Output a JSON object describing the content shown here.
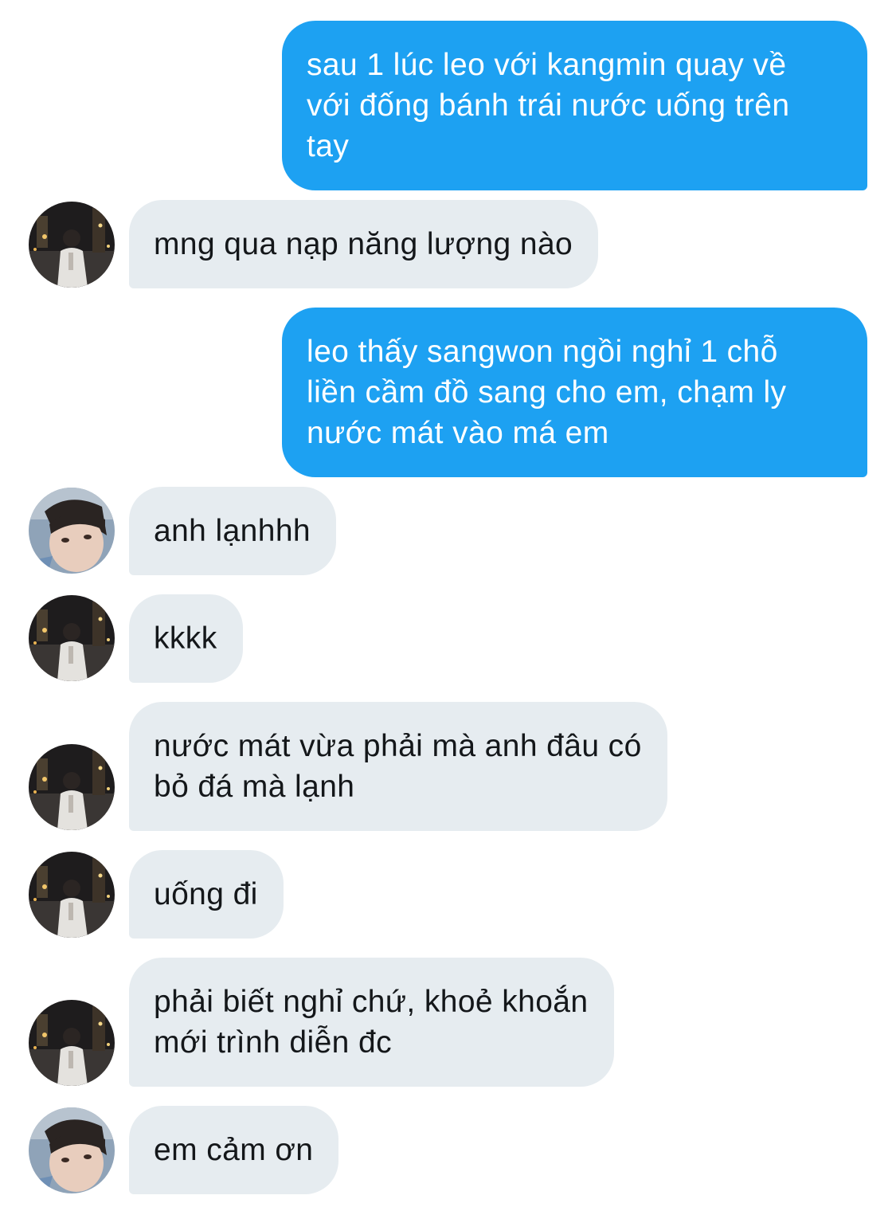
{
  "conversation": {
    "messages": [
      {
        "direction": "out",
        "text": "sau 1 lúc leo với kangmin quay về\nvới đống bánh trái nước uống trên\ntay"
      },
      {
        "direction": "in",
        "avatar": "night-street-avatar",
        "text": "mng qua nạp năng lượng nào"
      },
      {
        "direction": "out",
        "text": "leo thấy sangwon ngồi nghỉ 1 chỗ\nliền cầm đồ sang cho em, chạm ly\nnước mát vào má em"
      },
      {
        "direction": "in",
        "avatar": "selfie-avatar",
        "text": "anh lạnhhh"
      },
      {
        "direction": "in",
        "avatar": "night-street-avatar",
        "text": "kkkk"
      },
      {
        "direction": "in",
        "avatar": "night-street-avatar",
        "text": "nước mát vừa phải mà anh đâu có\nbỏ đá mà lạnh"
      },
      {
        "direction": "in",
        "avatar": "night-street-avatar",
        "text": "uống đi"
      },
      {
        "direction": "in",
        "avatar": "night-street-avatar",
        "text": "phải biết nghỉ chứ, khoẻ khoắn\nmới trình diễn đc"
      },
      {
        "direction": "in",
        "avatar": "selfie-avatar",
        "text": "em cảm ơn"
      }
    ]
  },
  "colors": {
    "outgoing_bubble": "#1da1f2",
    "incoming_bubble": "#e6ecf0",
    "incoming_text": "#14171a",
    "outgoing_text": "#ffffff"
  }
}
